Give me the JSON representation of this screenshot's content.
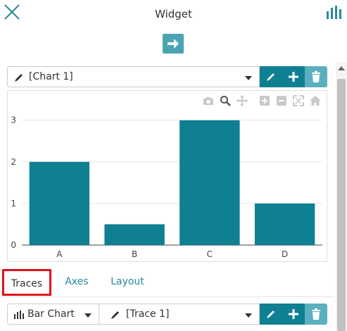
{
  "header": {
    "title": "Widget"
  },
  "chart_selector": {
    "value": "[Chart 1]"
  },
  "chart_data": {
    "type": "bar",
    "categories": [
      "A",
      "B",
      "C",
      "D"
    ],
    "values": [
      2,
      0.5,
      3,
      1
    ],
    "title": "",
    "xlabel": "",
    "ylabel": "",
    "ylim": [
      0,
      3.3
    ],
    "yticks": [
      0,
      1,
      2,
      3
    ],
    "grid": true,
    "bar_color": "#0e8092"
  },
  "tabs": [
    {
      "label": "Traces",
      "active": true
    },
    {
      "label": "Axes",
      "active": false
    },
    {
      "label": "Layout",
      "active": false
    }
  ],
  "trace_type": {
    "value": "Bar Chart"
  },
  "trace_selector": {
    "value": "[Trace 1]"
  },
  "colors": {
    "accent": "#0e8092",
    "accent_light": "#5ab0bf",
    "active_tab_border": "#e0121b"
  }
}
